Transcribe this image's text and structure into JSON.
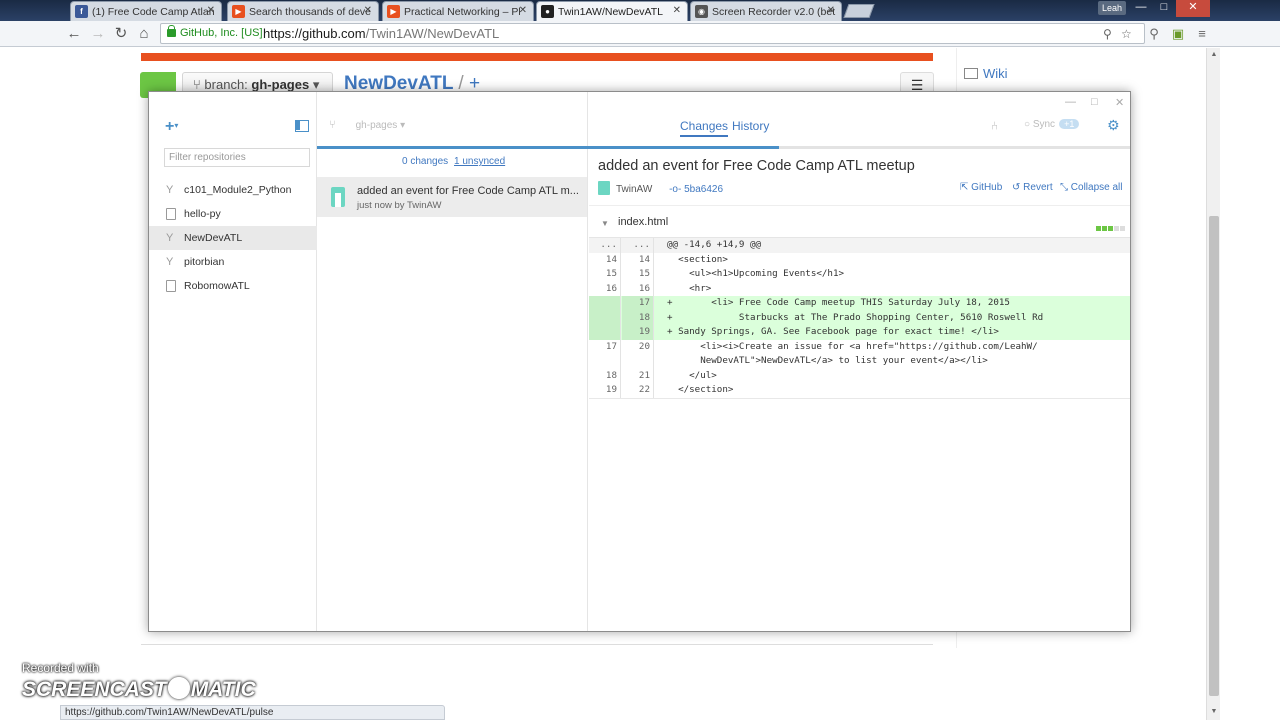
{
  "browser": {
    "tabs": [
      {
        "label": "(1) Free Code Camp Atlan",
        "favicon": "facebook-icon",
        "color": "#3b5998"
      },
      {
        "label": "Search thousands of deve",
        "favicon": "play-icon",
        "color": "#e8501f"
      },
      {
        "label": "Practical Networking – Pl",
        "favicon": "play-icon",
        "color": "#e8501f"
      },
      {
        "label": "Twin1AW/NewDevATL",
        "favicon": "github-icon",
        "color": "#222222"
      },
      {
        "label": "Screen Recorder v2.0 (bet",
        "favicon": "som-icon",
        "color": "#555555"
      }
    ],
    "user_badge": "Leah",
    "ev_cert": "GitHub, Inc. [US]",
    "url_origin": "https://github.com",
    "url_path": "/Twin1AW/NewDevATL",
    "status_url": "https://github.com/Twin1AW/NewDevATL/pulse"
  },
  "github_page": {
    "branch_label": "branch:",
    "branch_name": "gh-pages",
    "repo_name": "NewDevATL",
    "path_sep": "/",
    "path_add": "+",
    "wiki": "Wiki"
  },
  "app": {
    "filter_placeholder": "Filter repositories",
    "repos": [
      {
        "name": "c101_Module2_Python",
        "icon": "fork-icon"
      },
      {
        "name": "hello-py",
        "icon": "repo-icon"
      },
      {
        "name": "NewDevATL",
        "icon": "fork-icon",
        "selected": true
      },
      {
        "name": "pitorbian",
        "icon": "fork-icon"
      },
      {
        "name": "RobomowATL",
        "icon": "repo-icon"
      }
    ],
    "current_branch": "gh-pages",
    "tab_changes": "Changes",
    "tab_history": "History",
    "sync_label": "Sync",
    "sync_count": "+1",
    "changes_count": "0 changes",
    "unsynced_count": "1 unsynced",
    "commit": {
      "title": "added an event for Free Code Camp ATL m...",
      "meta": "just now by TwinAW",
      "full_title": "added an event for Free Code Camp ATL meetup",
      "author": "TwinAW",
      "sha": "5ba6426"
    },
    "actions": {
      "github": "GitHub",
      "revert": "Revert",
      "collapse": "Collapse all"
    },
    "file": {
      "name": "index.html"
    },
    "diff": [
      {
        "type": "hunk",
        "old": "...",
        "new": "...",
        "code": "@@ -14,6 +14,9 @@"
      },
      {
        "type": "ctx",
        "old": "14",
        "new": "14",
        "code": "  <section>"
      },
      {
        "type": "ctx",
        "old": "15",
        "new": "15",
        "code": "    <ul><h1>Upcoming Events</h1>"
      },
      {
        "type": "ctx",
        "old": "16",
        "new": "16",
        "code": "    <hr>"
      },
      {
        "type": "add",
        "old": "",
        "new": "17",
        "code": "+       <li> Free Code Camp meetup THIS Saturday July 18, 2015"
      },
      {
        "type": "add",
        "old": "",
        "new": "18",
        "code": "+            Starbucks at The Prado Shopping Center, 5610 Roswell Rd"
      },
      {
        "type": "add",
        "old": "",
        "new": "19",
        "code": "+ Sandy Springs, GA. See Facebook page for exact time! </li>"
      },
      {
        "type": "ctx",
        "old": "17",
        "new": "20",
        "code": "      <li><i>Create an issue for <a href=\"https://github.com/LeahW/"
      },
      {
        "type": "ctx",
        "old": "",
        "new": "",
        "code": "      NewDevATL\">NewDevATL</a> to list your event</a></li>"
      },
      {
        "type": "ctx",
        "old": "18",
        "new": "21",
        "code": "    </ul>"
      },
      {
        "type": "ctx",
        "old": "19",
        "new": "22",
        "code": "  </section>"
      }
    ]
  },
  "watermark": {
    "recorded": "Recorded with",
    "brand_left": "SCREENCAST",
    "brand_right": "MATIC"
  }
}
